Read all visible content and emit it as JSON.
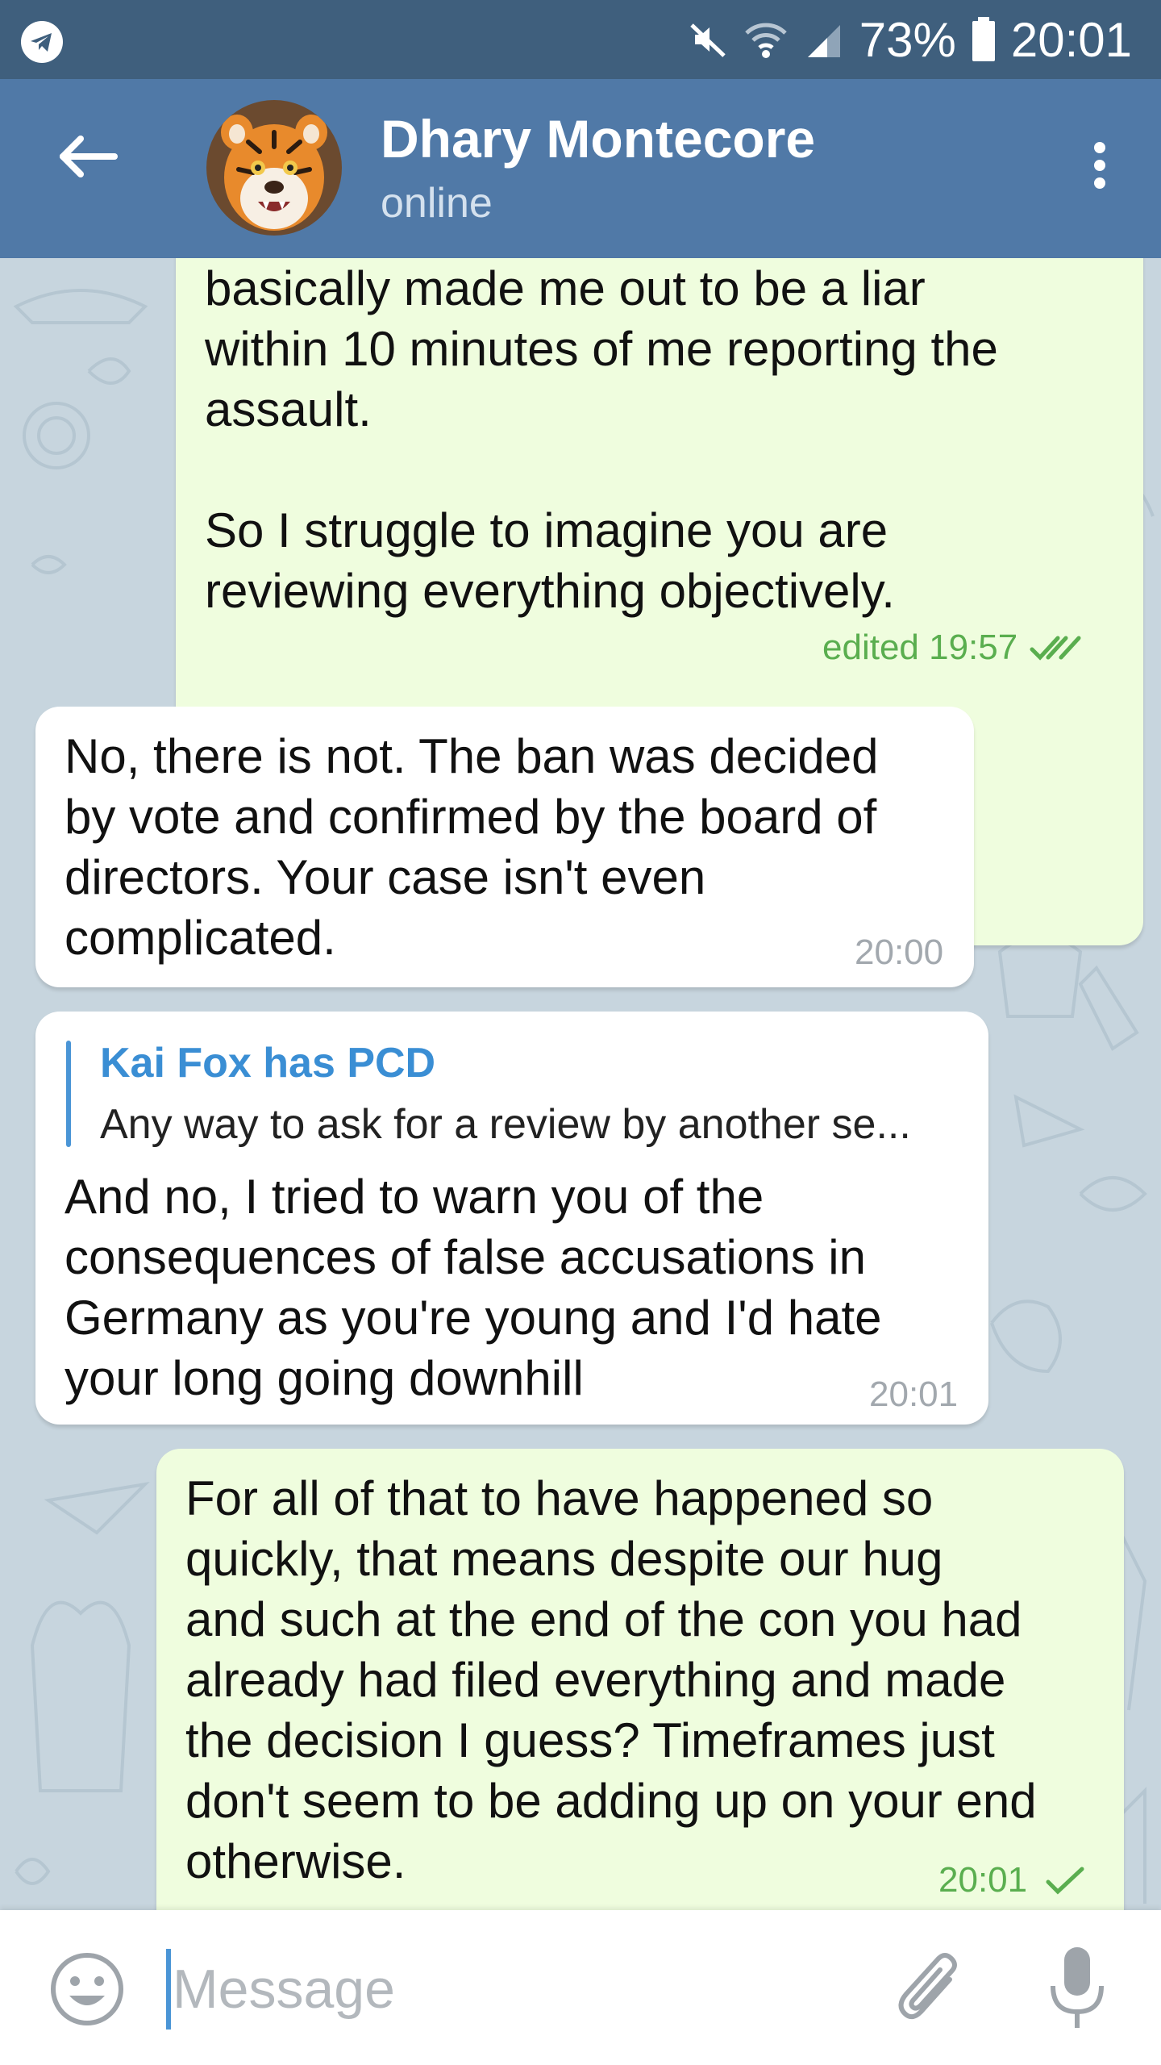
{
  "status_bar": {
    "battery": "73%",
    "time": "20:01",
    "icons": [
      "telegram-icon",
      "mute-icon",
      "wifi-icon",
      "signal-icon",
      "battery-icon"
    ]
  },
  "header": {
    "title": "Dhary Montecore",
    "subtitle": "online",
    "icons": [
      "back-arrow-icon",
      "more-vertical-icon"
    ],
    "color": "#5079a7"
  },
  "messages": [
    {
      "direction": "out",
      "text": "basically made me out to be a liar\nwithin 10 minutes of me reporting the\nassault.\n\nSo I struggle to imagine you are\nreviewing everything objectively.",
      "meta": "edited 19:57",
      "status": "read"
    },
    {
      "direction": "in",
      "text": "No, there is not. The ban was decided\nby vote and confirmed by the board of\ndirectors. Your case isn't even\ncomplicated.",
      "meta": "20:00"
    },
    {
      "direction": "in",
      "reply": {
        "name": "Kai Fox has PCD",
        "text": "Any way to ask for a review by another se..."
      },
      "text": "And no, I tried to warn you of the\nconsequences of false accusations in\nGermany as you're young and I'd hate\nyour long going downhill",
      "meta": "20:01"
    },
    {
      "direction": "out",
      "text": "For all of that to have happened so\nquickly, that means despite our hug\nand such at the end of the con you had\nalready had filed everything and made\nthe decision I guess? Timeframes just\ndon't seem to be adding up on your end\notherwise.",
      "meta": "20:01",
      "status": "sent"
    }
  ],
  "composer": {
    "placeholder": "Message",
    "value": "",
    "icons": [
      "emoji-icon",
      "attach-icon",
      "microphone-icon"
    ]
  },
  "colors": {
    "outgoing_bubble": "#effdde",
    "incoming_bubble": "#ffffff",
    "check_marks": "#5aae4f",
    "reply_accent": "#3a8ed4",
    "chat_background": "#c7d5de"
  }
}
